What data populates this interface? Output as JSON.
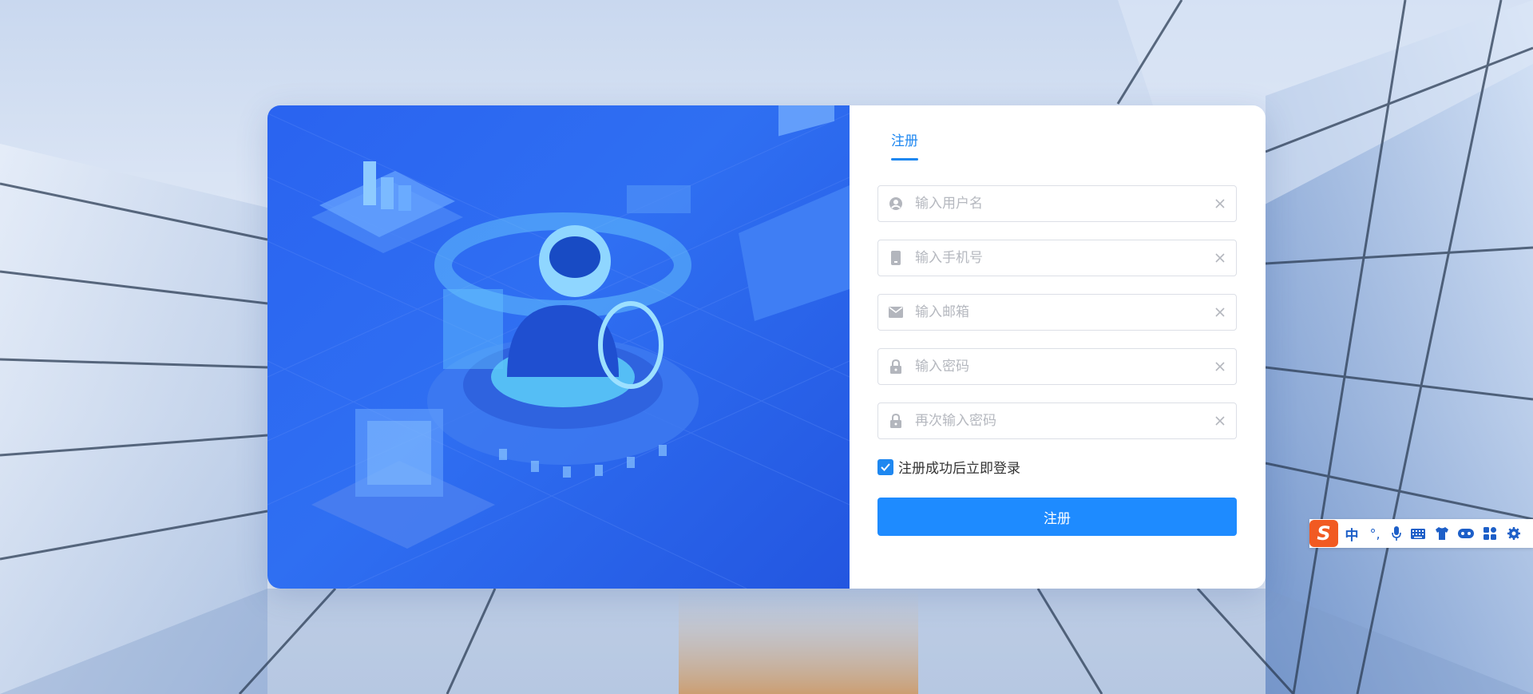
{
  "tab": {
    "label": "注册"
  },
  "fields": {
    "username": {
      "placeholder": "输入用户名"
    },
    "phone": {
      "placeholder": "输入手机号"
    },
    "email": {
      "placeholder": "输入邮箱"
    },
    "password": {
      "placeholder": "输入密码"
    },
    "confirm_password": {
      "placeholder": "再次输入密码"
    }
  },
  "auto_login": {
    "label": "注册成功后立即登录",
    "checked": true
  },
  "submit": {
    "label": "注册"
  },
  "ime": {
    "logo": "S",
    "mode": "中",
    "punct": "°,",
    "icons": [
      "mic-icon",
      "keyboard-icon",
      "shirt-icon",
      "gamepad-icon",
      "apps-icon",
      "settings-icon"
    ]
  },
  "colors": {
    "accent": "#1e87f0",
    "button": "#1e8bff",
    "illustration": "#2a63f0"
  }
}
